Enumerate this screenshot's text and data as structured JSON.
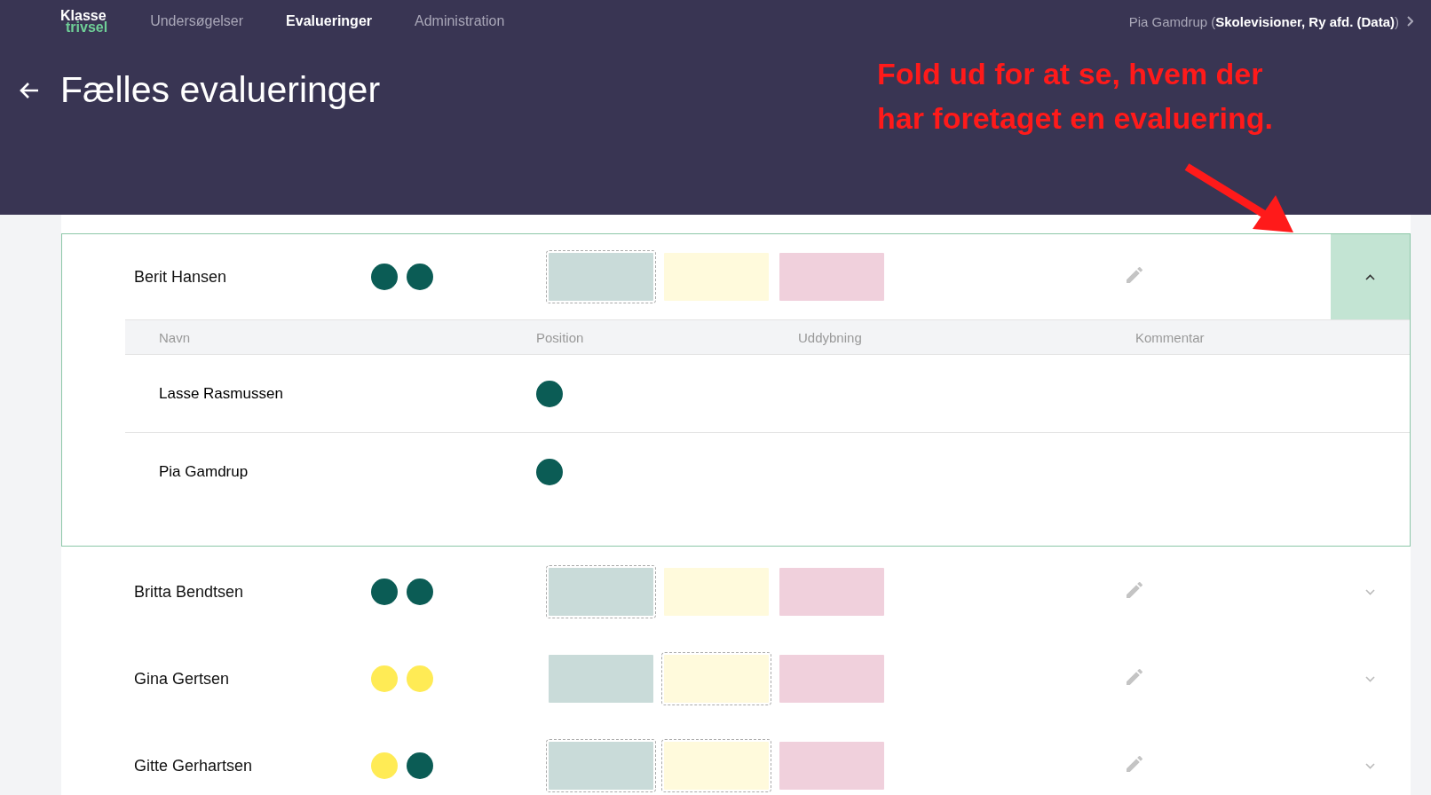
{
  "header": {
    "logo": {
      "top": "Klasse",
      "bottom": "trivsel"
    },
    "nav": [
      {
        "label": "Undersøgelser",
        "selected": false
      },
      {
        "label": "Evalueringer",
        "selected": true
      },
      {
        "label": "Administration",
        "selected": false
      }
    ],
    "user": "Pia Gamdrup (**Skolevisioner, Ry afd. (Data)**)",
    "title": "Fælles evalueringer"
  },
  "annotation": {
    "lines": [
      "Fold ud for at se, hvem der",
      "har foretaget en evaluering."
    ]
  },
  "rows": [
    {
      "name": "Berit Hansen",
      "expanded": true,
      "dots": [
        {
          "color": "#0b5c55"
        },
        {
          "color": "#0b5c55"
        }
      ],
      "boxes": [
        {
          "color": "#c9dbd9",
          "selected": true
        },
        {
          "color": "#fffadc",
          "selected": false
        },
        {
          "color": "#f0d0dc",
          "selected": false
        }
      ],
      "details": {
        "columns": [
          "Navn",
          "Position",
          "Uddybning",
          "Kommentar"
        ],
        "rows": [
          {
            "name": "Lasse Rasmussen",
            "color": "#0b5c55"
          },
          {
            "name": "Pia Gamdrup",
            "color": "#0b5c55"
          }
        ]
      }
    },
    {
      "name": "Britta Bendtsen",
      "expanded": false,
      "dots": [
        {
          "color": "#0b5c55"
        },
        {
          "color": "#0b5c55"
        }
      ],
      "boxes": [
        {
          "color": "#c9dbd9",
          "selected": true
        },
        {
          "color": "#fffadc",
          "selected": false
        },
        {
          "color": "#f0d0dc",
          "selected": false
        }
      ]
    },
    {
      "name": "Gina Gertsen",
      "expanded": false,
      "dots": [
        {
          "color": "#ffeb55"
        },
        {
          "color": "#ffeb55"
        }
      ],
      "boxes": [
        {
          "color": "#c9dbd9",
          "selected": false
        },
        {
          "color": "#fffadc",
          "selected": true
        },
        {
          "color": "#f0d0dc",
          "selected": false
        }
      ]
    },
    {
      "name": "Gitte Gerhartsen",
      "expanded": false,
      "dots": [
        {
          "color": "#ffeb55"
        },
        {
          "color": "#0b5c55"
        }
      ],
      "boxes": [
        {
          "color": "#c9dbd9",
          "selected": true
        },
        {
          "color": "#fffadc",
          "selected": true
        },
        {
          "color": "#f0d0dc",
          "selected": false
        }
      ]
    }
  ]
}
